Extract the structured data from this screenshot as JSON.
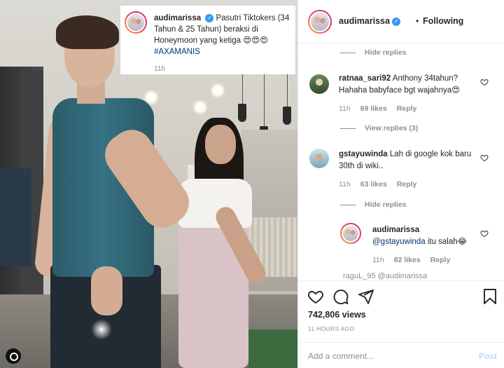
{
  "post": {
    "username": "audimarissa",
    "verified_mark": "✓",
    "follow_dot": "•",
    "follow_status": "Following",
    "caption": {
      "text": "Pasutri Tiktokers (34 Tahun & 25 Tahun) beraksi di Honeymoon yang ketiga 😍😍😍",
      "hashtag": "#AXAMANIS",
      "time": "11h"
    },
    "views": "742,806 views",
    "posted_ago": "11 HOURS AGO"
  },
  "comments": {
    "hide_replies_1": "Hide replies",
    "items": [
      {
        "username": "ratnaa_sari92",
        "text": "Anthony 34tahun? Hahaha babyface bgt wajahnya😍",
        "time": "11h",
        "likes": "69 likes",
        "reply": "Reply"
      },
      {
        "username": "gstayuwinda",
        "text": "Lah di google kok baru 30th di wiki..",
        "time": "11h",
        "likes": "63 likes",
        "reply": "Reply"
      }
    ],
    "view_replies": "View replies (3)",
    "hide_replies_2": "Hide replies",
    "reply": {
      "username": "audimarissa",
      "mention": "@gstayuwinda",
      "text": "itu salah😂",
      "time": "11h",
      "likes": "82 likes",
      "reply": "Reply"
    },
    "partial": "raguL_95 @audimarissa"
  },
  "add_comment": {
    "placeholder": "Add a comment...",
    "post_label": "Post"
  },
  "colors": {
    "accent_link": "#00376b",
    "verified": "#3897f0",
    "post_disabled": "#b3dbff",
    "muted": "#8e8e8e"
  },
  "icons": [
    "heart-icon",
    "comment-icon",
    "share-icon",
    "bookmark-icon",
    "verified-badge-icon",
    "small-heart-icon"
  ]
}
